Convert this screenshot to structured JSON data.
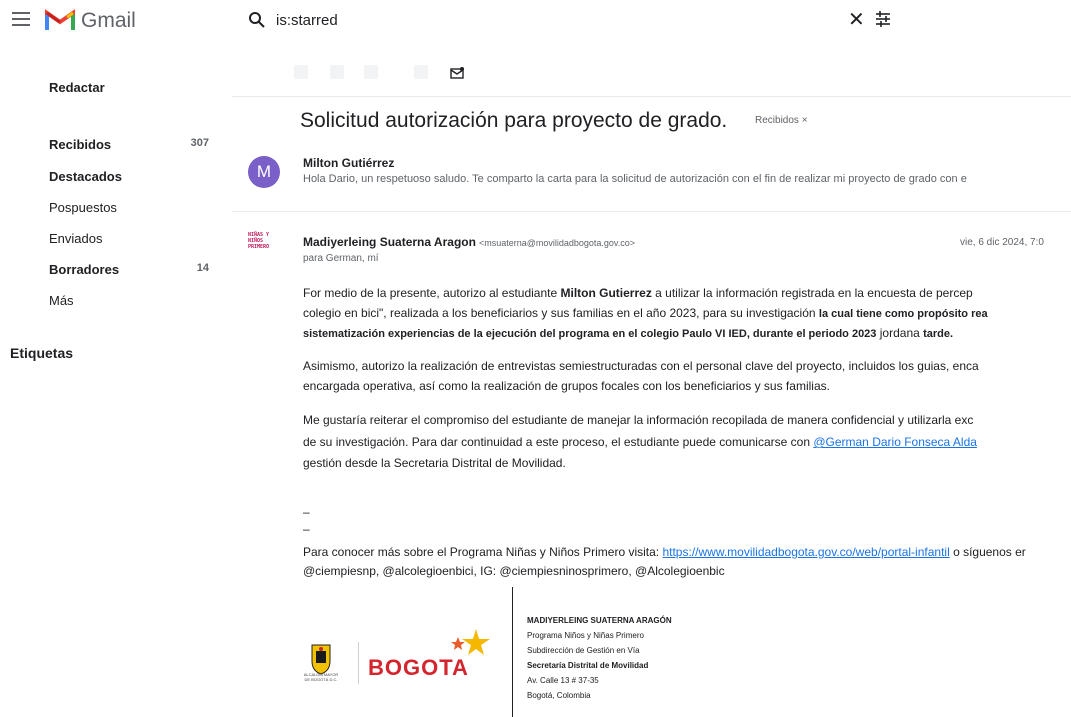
{
  "header": {
    "app_name": "Gmail",
    "search_query": "is:starred",
    "icons": [
      "menu-icon",
      "gmail-logo-icon",
      "search-icon",
      "clear-icon",
      "search-options-icon"
    ]
  },
  "sidebar": {
    "compose_label": "Redactar",
    "items": [
      {
        "label": "Recibidos",
        "count": "307"
      },
      {
        "label": "Destacados",
        "count": ""
      },
      {
        "label": "Pospuestos",
        "count": ""
      },
      {
        "label": "Enviados",
        "count": ""
      },
      {
        "label": "Borradores",
        "count": "14"
      },
      {
        "label": "Más",
        "count": ""
      }
    ],
    "labels_heading": "Etiquetas"
  },
  "thread": {
    "subject": "Solicitud autorización para proyecto de grado.",
    "label_chip": "Recibidos ×",
    "messages": [
      {
        "avatar_letter": "M",
        "sender": "Milton Gutiérrez",
        "snippet": "Hola Dario, un respetuoso saludo. Te comparto la carta para la solicitud de autorización con el fin de realizar mi proyecto de grado con e"
      },
      {
        "avatar_text": "NIÑAS Y NIÑOS PRIMERO",
        "sender": "Madiyerleing Suaterna Aragon",
        "sender_email": "<msuaterna@movilidadbogota.gov.co>",
        "to": "para German, mí",
        "date": "vie, 6 dic 2024, 7:0",
        "body": {
          "p1_l1_a": "For medio de la presente, autorizo al estudiante ",
          "p1_l1_b": "Milton Gutierrez",
          "p1_l1_c": " a utilizar la información registrada en la encuesta de percep",
          "p1_l2_a": "colegio en bici\", realizada a los beneficiarios y sus familias en el año 2023, para su investigación ",
          "p1_l2_b": "la cual tiene como propósito rea",
          "p1_l3_a": "sistematización experiencias de la ejecución del programa en el colegio Paulo VI IED, durante el periodo 2023",
          "p1_l3_b": " jordana ",
          "p1_l3_c": "tarde.",
          "p2_l1": "Asimismo, autorizo la realización de entrevistas semiestructuradas con el personal clave del proyecto, incluidos los guias, enca",
          "p2_l2": "encargada operativa, así como la realización de grupos focales con los beneficiarios y sus familias.",
          "p3_l1": "Me gustaría reiterar el compromiso del estudiante de manejar la información recopilada de manera confidencial y utilizarla exc",
          "p3_l2_a": "de su investigación. Para dar continuidad a este proceso, el estudiante puede comunicarse con ",
          "p3_l2_link": "@German Dario Fonseca Alda",
          "p3_l3": "gestión desde la Secretaria Distrital de Movilidad.",
          "dash1": "–",
          "dash2": "–",
          "p4_l1_a": "Para conocer más sobre el Programa Niñas y Niños Primero visita: ",
          "p4_l1_link": "https://www.movilidadbogota.gov.co/web/portal-infantil",
          "p4_l1_b": " o síguenos er",
          "p4_l2": "@ciempiesnp, @alcolegioenbici, IG: @ciempiesninosprimero, @Alcolegioenbic"
        },
        "signature": {
          "crest_caption": "ALCALDÍA MAYOR DE BOGOTÁ D.C.",
          "logo_text": "BOGOTA",
          "name": "MADIYERLEING SUATERNA ARAGÓN",
          "line1": "Programa Niños y Niñas Primero",
          "line2": "Subdirección de Gestión en Vía",
          "line3": "Secretaría Distrital de Movilidad",
          "line4": "Av. Calle 13 # 37-35",
          "line5": "Bogotá, Colombia"
        }
      }
    ]
  },
  "colors": {
    "avatar_purple": "#7b5fc9",
    "link_blue": "#1a73e8",
    "bogota_red": "#d4242e",
    "star_yellow": "#f5b700"
  }
}
